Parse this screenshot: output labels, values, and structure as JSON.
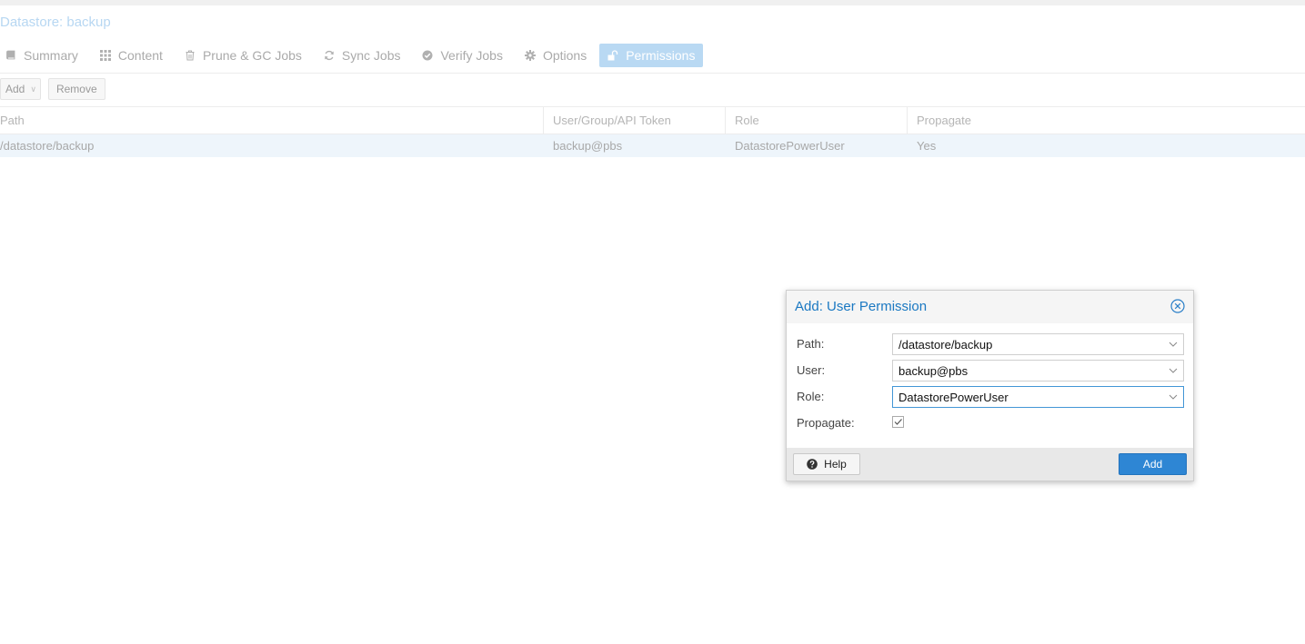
{
  "header": {
    "title": "Datastore: backup"
  },
  "tabs": [
    {
      "label": "Summary",
      "icon": "book-icon",
      "active": false
    },
    {
      "label": "Content",
      "icon": "grid-icon",
      "active": false
    },
    {
      "label": "Prune & GC Jobs",
      "icon": "trash-icon",
      "active": false
    },
    {
      "label": "Sync Jobs",
      "icon": "refresh-icon",
      "active": false
    },
    {
      "label": "Verify Jobs",
      "icon": "check-circle-icon",
      "active": false
    },
    {
      "label": "Options",
      "icon": "gear-icon",
      "active": false
    },
    {
      "label": "Permissions",
      "icon": "unlock-icon",
      "active": true
    }
  ],
  "toolbar": {
    "add_label": "Add",
    "remove_label": "Remove"
  },
  "grid": {
    "columns": [
      "Path",
      "User/Group/API Token",
      "Role",
      "Propagate"
    ],
    "rows": [
      {
        "path": "/datastore/backup",
        "user": "backup@pbs",
        "role": "DatastorePowerUser",
        "propagate": "Yes"
      }
    ]
  },
  "dialog": {
    "title": "Add: User Permission",
    "path_label": "Path:",
    "path_value": "/datastore/backup",
    "user_label": "User:",
    "user_value": "backup@pbs",
    "role_label": "Role:",
    "role_value": "DatastorePowerUser",
    "propagate_label": "Propagate:",
    "propagate_checked": true,
    "help_label": "Help",
    "add_label": "Add"
  },
  "colors": {
    "accent": "#2e86d4",
    "title_blue": "#1a78c2",
    "active_tab": "#b9d9f3",
    "row_selected": "#eef5fb"
  }
}
